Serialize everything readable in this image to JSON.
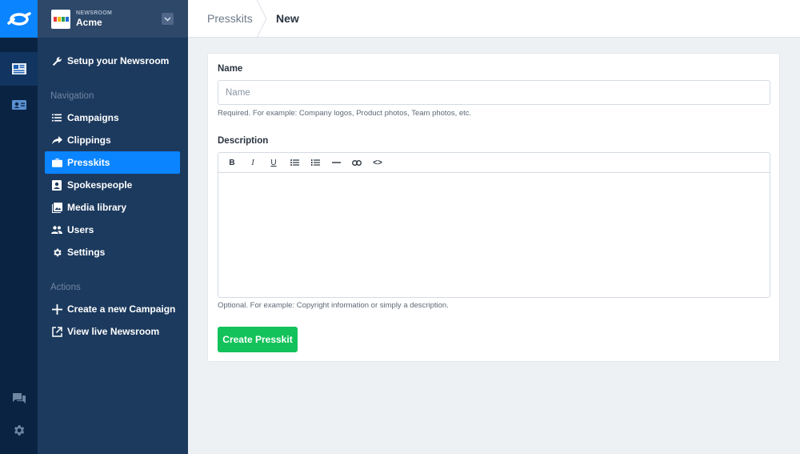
{
  "newsroom": {
    "label": "NEWSROOM",
    "name": "Acme"
  },
  "sidebar": {
    "setup": "Setup your Newsroom",
    "navigation_heading": "Navigation",
    "nav_items": [
      {
        "label": "Campaigns",
        "icon": "list-icon"
      },
      {
        "label": "Clippings",
        "icon": "share-arrow-icon"
      },
      {
        "label": "Presskits",
        "icon": "briefcase-icon",
        "active": true
      },
      {
        "label": "Spokespeople",
        "icon": "contact-icon"
      },
      {
        "label": "Media library",
        "icon": "image-icon"
      },
      {
        "label": "Users",
        "icon": "users-icon"
      },
      {
        "label": "Settings",
        "icon": "gear-icon"
      }
    ],
    "actions_heading": "Actions",
    "actions": [
      {
        "label": "Create a new Campaign",
        "icon": "plus-icon"
      },
      {
        "label": "View live Newsroom",
        "icon": "external-link-icon"
      }
    ]
  },
  "breadcrumb": {
    "parent": "Presskits",
    "current": "New"
  },
  "form": {
    "name_label": "Name",
    "name_placeholder": "Name",
    "name_value": "",
    "name_help": "Required. For example: Company logos, Product photos, Team photos, etc.",
    "description_label": "Description",
    "toolbar": {
      "bold": "B",
      "italic": "I",
      "underline": "U",
      "bullet_list": "bulleted-list-icon",
      "numbered_list": "numbered-list-icon",
      "horizontal_rule": "horizontal-rule-icon",
      "link": "link-icon",
      "code": "<>"
    },
    "description_help": "Optional. For example: Copyright information or simply a description.",
    "submit_label": "Create Presskit"
  },
  "colors": {
    "accent": "#0a84ff",
    "rail": "#0a2342",
    "sidebar": "#1c3a5e",
    "success": "#13c25a"
  }
}
